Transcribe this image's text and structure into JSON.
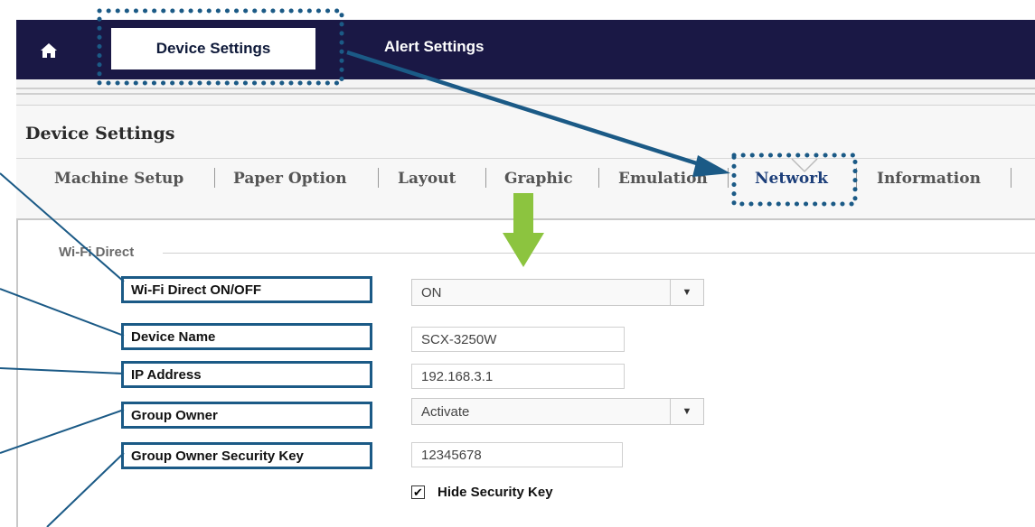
{
  "topnav": {
    "home_icon": "home-icon",
    "tabs": [
      {
        "label": "Device Settings",
        "selected": true
      },
      {
        "label": "Alert Settings",
        "selected": false
      }
    ]
  },
  "page": {
    "title": "Device Settings",
    "subtabs": [
      "Machine Setup",
      "Paper Option",
      "Layout",
      "Graphic",
      "Emulation",
      "Network",
      "Information"
    ],
    "active_subtab": "Network"
  },
  "wifi_direct": {
    "legend": "Wi-Fi Direct",
    "fields": {
      "onoff": {
        "label": "Wi-Fi Direct ON/OFF",
        "value": "ON"
      },
      "device_name": {
        "label": "Device Name",
        "value": "SCX-3250W"
      },
      "ip_address": {
        "label": "IP Address",
        "value": "192.168.3.1"
      },
      "group_owner": {
        "label": "Group Owner",
        "value": "Activate"
      },
      "security_key": {
        "label": "Group Owner Security Key",
        "value": "12345678"
      }
    },
    "hide_key": {
      "label": "Hide Security Key",
      "checked": true
    }
  },
  "colors": {
    "nav_bg": "#1a1845",
    "callout_blue": "#1b5a86",
    "arrow_green": "#8cc43f",
    "active_tab_text": "#1d3f7a"
  }
}
